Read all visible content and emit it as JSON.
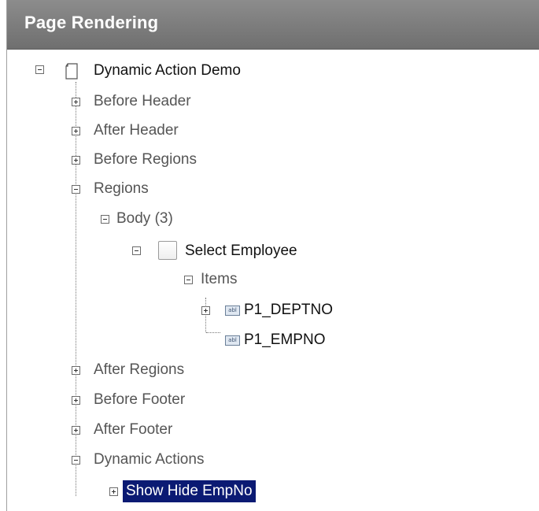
{
  "panel": {
    "title": "Page Rendering"
  },
  "tree": {
    "root": {
      "label": "Dynamic Action Demo",
      "icon": "page-icon"
    },
    "before_header": {
      "label": "Before Header"
    },
    "after_header": {
      "label": "After Header"
    },
    "before_regions": {
      "label": "Before Regions"
    },
    "regions": {
      "label": "Regions"
    },
    "body": {
      "label": "Body (3)"
    },
    "select_employee": {
      "label": "Select Employee",
      "icon": "region-icon"
    },
    "items": {
      "label": "Items"
    },
    "p1_deptno": {
      "label": "P1_DEPTNO",
      "icon": "text-field-icon",
      "icon_text": "abl"
    },
    "p1_empno": {
      "label": "P1_EMPNO",
      "icon": "text-field-icon",
      "icon_text": "abl"
    },
    "after_regions": {
      "label": "After Regions"
    },
    "before_footer": {
      "label": "Before Footer"
    },
    "after_footer": {
      "label": "After Footer"
    },
    "dynamic_actions": {
      "label": "Dynamic Actions"
    },
    "show_hide_empno": {
      "label": "Show Hide EmpNo",
      "selected": true
    }
  },
  "colors": {
    "header": "#7a7a7a",
    "selection": "#0b1a73"
  }
}
